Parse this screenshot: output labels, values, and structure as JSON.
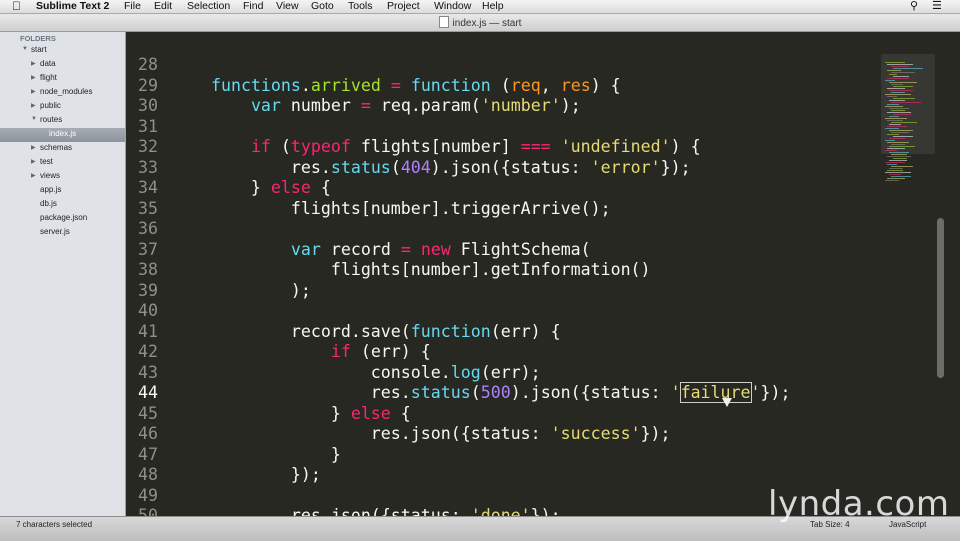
{
  "menubar": {
    "app_name": "Sublime Text 2",
    "items": [
      "File",
      "Edit",
      "Selection",
      "Find",
      "View",
      "Goto",
      "Tools",
      "Project",
      "Window",
      "Help"
    ]
  },
  "window": {
    "title": "index.js — start"
  },
  "sidebar": {
    "header": "FOLDERS",
    "root": "start",
    "items": [
      {
        "label": "data",
        "type": "folder"
      },
      {
        "label": "flight",
        "type": "folder"
      },
      {
        "label": "node_modules",
        "type": "folder"
      },
      {
        "label": "public",
        "type": "folder"
      },
      {
        "label": "routes",
        "type": "folder-open"
      },
      {
        "label": "index.js",
        "type": "file",
        "selected": true
      },
      {
        "label": "schemas",
        "type": "folder"
      },
      {
        "label": "test",
        "type": "folder"
      },
      {
        "label": "views",
        "type": "folder"
      },
      {
        "label": "app.js",
        "type": "file"
      },
      {
        "label": "db.js",
        "type": "file"
      },
      {
        "label": "package.json",
        "type": "file"
      },
      {
        "label": "server.js",
        "type": "file"
      }
    ]
  },
  "editor": {
    "current_line": 44,
    "lines": [
      {
        "n": "28",
        "tokens": []
      },
      {
        "n": "29",
        "tokens": [
          [
            "",
            "    "
          ],
          [
            "f",
            "functions"
          ],
          [
            "",
            "."
          ],
          [
            "g",
            "arrived"
          ],
          [
            "",
            " "
          ],
          [
            "k",
            "="
          ],
          [
            "",
            " "
          ],
          [
            "f",
            "function"
          ],
          [
            "",
            " ("
          ],
          [
            "p",
            "req"
          ],
          [
            "",
            ", "
          ],
          [
            "p",
            "res"
          ],
          [
            "",
            ") {"
          ]
        ]
      },
      {
        "n": "30",
        "tokens": [
          [
            "",
            "        "
          ],
          [
            "f",
            "var"
          ],
          [
            "",
            " number "
          ],
          [
            "k",
            "="
          ],
          [
            "",
            " req.param("
          ],
          [
            "s",
            "'number'"
          ],
          [
            "",
            ");"
          ]
        ]
      },
      {
        "n": "31",
        "tokens": []
      },
      {
        "n": "32",
        "tokens": [
          [
            "",
            "        "
          ],
          [
            "k",
            "if"
          ],
          [
            "",
            " ("
          ],
          [
            "k",
            "typeof"
          ],
          [
            "",
            " flights[number] "
          ],
          [
            "k",
            "==="
          ],
          [
            "",
            " "
          ],
          [
            "s",
            "'undefined'"
          ],
          [
            "",
            ") {"
          ]
        ]
      },
      {
        "n": "33",
        "tokens": [
          [
            "",
            "            res."
          ],
          [
            "f",
            "status"
          ],
          [
            "",
            "("
          ],
          [
            "n",
            "404"
          ],
          [
            "",
            ").json({status: "
          ],
          [
            "s",
            "'error'"
          ],
          [
            "",
            "});"
          ]
        ]
      },
      {
        "n": "34",
        "tokens": [
          [
            "",
            "        } "
          ],
          [
            "k",
            "else"
          ],
          [
            "",
            " {"
          ]
        ]
      },
      {
        "n": "35",
        "tokens": [
          [
            "",
            "            flights[number].triggerArrive();"
          ]
        ]
      },
      {
        "n": "36",
        "tokens": []
      },
      {
        "n": "37",
        "tokens": [
          [
            "",
            "            "
          ],
          [
            "f",
            "var"
          ],
          [
            "",
            " record "
          ],
          [
            "k",
            "="
          ],
          [
            "",
            " "
          ],
          [
            "k",
            "new"
          ],
          [
            "",
            " FlightSchema("
          ]
        ]
      },
      {
        "n": "38",
        "tokens": [
          [
            "",
            "                flights[number].getInformation()"
          ]
        ]
      },
      {
        "n": "39",
        "tokens": [
          [
            "",
            "            );"
          ]
        ]
      },
      {
        "n": "40",
        "tokens": []
      },
      {
        "n": "41",
        "tokens": [
          [
            "",
            "            record.save("
          ],
          [
            "f",
            "function"
          ],
          [
            "",
            "(err) {"
          ]
        ]
      },
      {
        "n": "42",
        "tokens": [
          [
            "",
            "                "
          ],
          [
            "k",
            "if"
          ],
          [
            "",
            " (err) {"
          ]
        ]
      },
      {
        "n": "43",
        "tokens": [
          [
            "",
            "                    console."
          ],
          [
            "f",
            "log"
          ],
          [
            "",
            "(err);"
          ]
        ]
      },
      {
        "n": "44",
        "tokens": [
          [
            "",
            "                    res."
          ],
          [
            "f",
            "status"
          ],
          [
            "",
            "("
          ],
          [
            "n",
            "500"
          ],
          [
            "",
            ").json({status: "
          ],
          [
            "s",
            "'"
          ],
          [
            "s hl",
            "failure"
          ],
          [
            "s",
            "'"
          ],
          [
            "",
            "});"
          ]
        ]
      },
      {
        "n": "45",
        "tokens": [
          [
            "",
            "                } "
          ],
          [
            "k",
            "else"
          ],
          [
            "",
            " {"
          ]
        ]
      },
      {
        "n": "46",
        "tokens": [
          [
            "",
            "                    res.json({status: "
          ],
          [
            "s",
            "'success'"
          ],
          [
            "",
            "});"
          ]
        ]
      },
      {
        "n": "47",
        "tokens": [
          [
            "",
            "                }"
          ]
        ]
      },
      {
        "n": "48",
        "tokens": [
          [
            "",
            "            });"
          ]
        ]
      },
      {
        "n": "49",
        "tokens": []
      },
      {
        "n": "50",
        "tokens": [
          [
            "",
            "            res.json({status: "
          ],
          [
            "s",
            "'done'"
          ],
          [
            "",
            "});"
          ]
        ]
      }
    ]
  },
  "statusbar": {
    "selection": "7 characters selected",
    "tab_size": "Tab Size: 4",
    "syntax": "JavaScript"
  },
  "watermark": "lynda.com",
  "colors": {
    "editor_bg": "#272822",
    "keyword": "#f92672",
    "string": "#e6db74",
    "number": "#ae81ff",
    "function": "#66d9ef",
    "property": "#a6e22e",
    "param": "#fd971f"
  }
}
